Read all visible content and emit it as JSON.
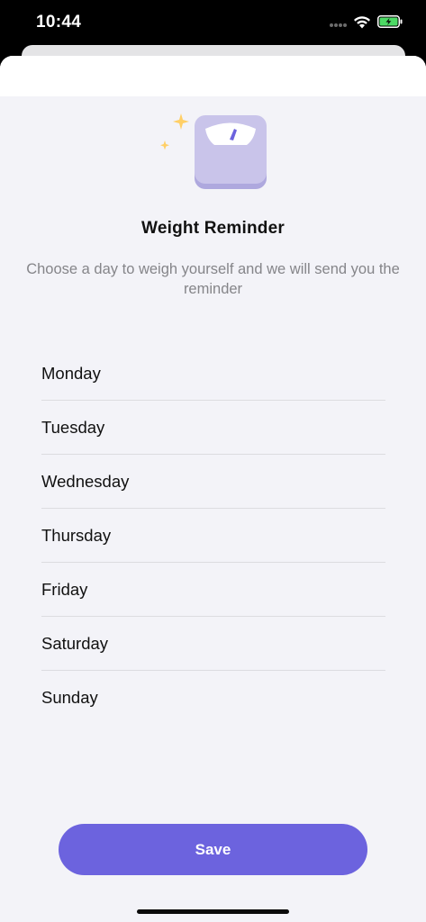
{
  "status_bar": {
    "time": "10:44",
    "icons": [
      "cellular-signal-icon",
      "wifi-icon",
      "battery-charging-icon"
    ],
    "battery_color": "#4cd964"
  },
  "illustration": {
    "icon": "weighing-scale-icon",
    "sparkle_icon": "sparkle-icon",
    "colors": {
      "scale_body": "#c9c4ea",
      "scale_shadow": "#aea8de",
      "needle": "#6c63de",
      "sparkle": "#ffcf66"
    }
  },
  "header": {
    "title": "Weight Reminder",
    "subtitle": "Choose a day to weigh yourself and we will send you the reminder"
  },
  "days": [
    {
      "label": "Monday"
    },
    {
      "label": "Tuesday"
    },
    {
      "label": "Wednesday"
    },
    {
      "label": "Thursday"
    },
    {
      "label": "Friday"
    },
    {
      "label": "Saturday"
    },
    {
      "label": "Sunday"
    }
  ],
  "actions": {
    "save_label": "Save",
    "accent_color": "#6c63de"
  }
}
